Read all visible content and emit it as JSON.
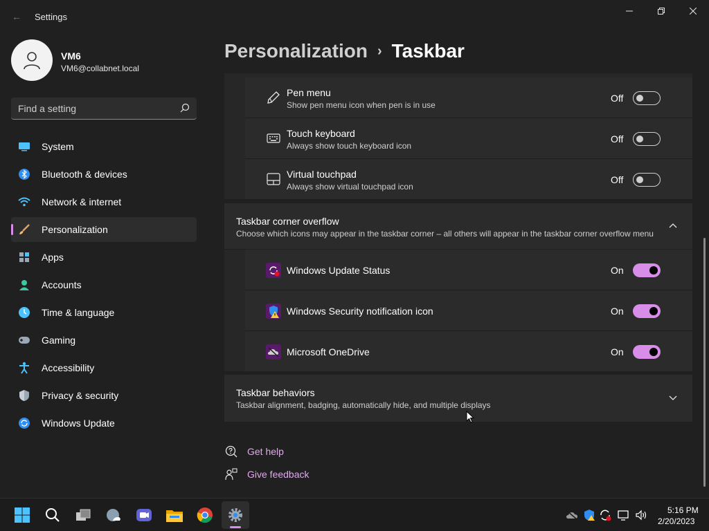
{
  "window": {
    "title": "Settings",
    "minimize_glyph": "—",
    "maximize_glyph": "❐",
    "close_glyph": "✕",
    "back_glyph": "←"
  },
  "profile": {
    "name": "VM6",
    "email": "VM6@collabnet.local"
  },
  "search": {
    "placeholder": "Find a setting"
  },
  "sidebar": {
    "items": [
      {
        "label": "System",
        "icon": "system-icon"
      },
      {
        "label": "Bluetooth & devices",
        "icon": "bluetooth-icon"
      },
      {
        "label": "Network & internet",
        "icon": "wifi-icon"
      },
      {
        "label": "Personalization",
        "icon": "brush-icon",
        "active": true
      },
      {
        "label": "Apps",
        "icon": "apps-icon"
      },
      {
        "label": "Accounts",
        "icon": "person-icon"
      },
      {
        "label": "Time & language",
        "icon": "clock-globe-icon"
      },
      {
        "label": "Gaming",
        "icon": "gamepad-icon"
      },
      {
        "label": "Accessibility",
        "icon": "accessibility-icon"
      },
      {
        "label": "Privacy & security",
        "icon": "shield-icon"
      },
      {
        "label": "Windows Update",
        "icon": "update-icon"
      }
    ]
  },
  "breadcrumb": {
    "parent": "Personalization",
    "separator": "›",
    "current": "Taskbar"
  },
  "corner_icons": [
    {
      "title": "Pen menu",
      "desc": "Show pen menu icon when pen is in use",
      "state": "Off",
      "icon": "pen-icon"
    },
    {
      "title": "Touch keyboard",
      "desc": "Always show touch keyboard icon",
      "state": "Off",
      "icon": "keyboard-icon"
    },
    {
      "title": "Virtual touchpad",
      "desc": "Always show virtual touchpad icon",
      "state": "Off",
      "icon": "touchpad-icon"
    }
  ],
  "overflow_section": {
    "title": "Taskbar corner overflow",
    "desc": "Choose which icons may appear in the taskbar corner – all others will appear in the taskbar corner overflow menu",
    "expanded": true,
    "items": [
      {
        "title": "Windows Update Status",
        "state": "On",
        "icon": "windows-update-status-icon"
      },
      {
        "title": "Windows Security notification icon",
        "state": "On",
        "icon": "windows-security-icon"
      },
      {
        "title": "Microsoft OneDrive",
        "state": "On",
        "icon": "onedrive-icon"
      }
    ]
  },
  "behaviors_section": {
    "title": "Taskbar behaviors",
    "desc": "Taskbar alignment, badging, automatically hide, and multiple displays",
    "expanded": false
  },
  "links": {
    "get_help": "Get help",
    "give_feedback": "Give feedback"
  },
  "taskbar": {
    "apps": [
      "start-icon",
      "search-icon",
      "task-view-icon",
      "widgets-icon",
      "chat-icon",
      "file-explorer-icon",
      "chrome-icon",
      "settings-icon"
    ],
    "clock_time": "5:16 PM",
    "clock_date": "2/20/2023"
  },
  "colors": {
    "accent": "#d88ee8",
    "link": "#e0a9ee",
    "background": "#202020",
    "card": "#2b2b2b"
  }
}
